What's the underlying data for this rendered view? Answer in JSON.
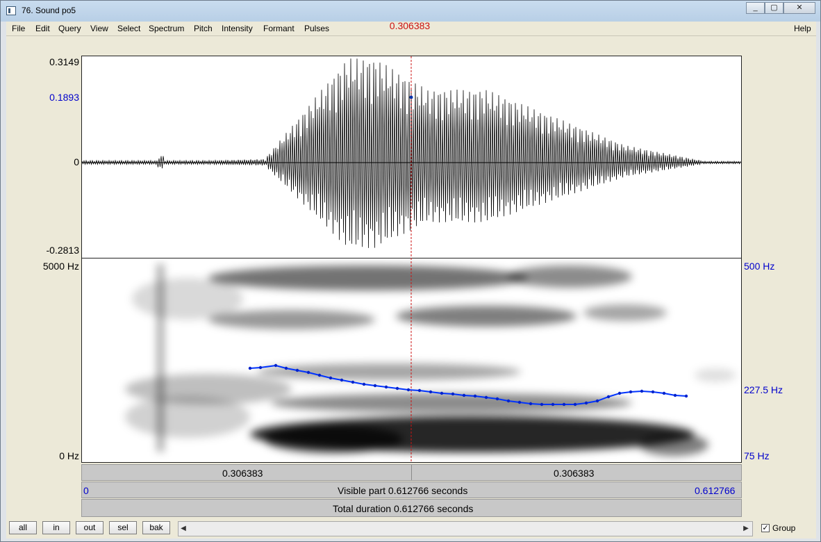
{
  "window": {
    "title": "76. Sound po5",
    "controls": [
      "_",
      "▢",
      "✕"
    ]
  },
  "menu": {
    "items": [
      "File",
      "Edit",
      "Query",
      "View",
      "Select",
      "Spectrum",
      "Pitch",
      "Intensity",
      "Formant",
      "Pulses"
    ],
    "help": "Help"
  },
  "cursor": {
    "time_label": "0.306383",
    "time": 0.306383
  },
  "waveform": {
    "y_max": "0.3149",
    "y_cursor": "0.1893",
    "y_zero": "0",
    "y_min": "-0.2813"
  },
  "spectrogram": {
    "y_top": "5000 Hz",
    "y_bottom": "0 Hz",
    "pitch_top": "500 Hz",
    "pitch_value": "227.5 Hz",
    "pitch_bottom": "75 Hz",
    "pitch_color": "#0033ff"
  },
  "time_bar": {
    "left": "0.306383",
    "right": "0.306383"
  },
  "visible_bar": {
    "start": "0",
    "label": "Visible part 0.612766 seconds",
    "end": "0.612766"
  },
  "total_bar": {
    "label": "Total duration 0.612766 seconds"
  },
  "buttons": [
    "all",
    "in",
    "out",
    "sel",
    "bak"
  ],
  "group": {
    "label": "Group",
    "checked": "✓"
  }
}
